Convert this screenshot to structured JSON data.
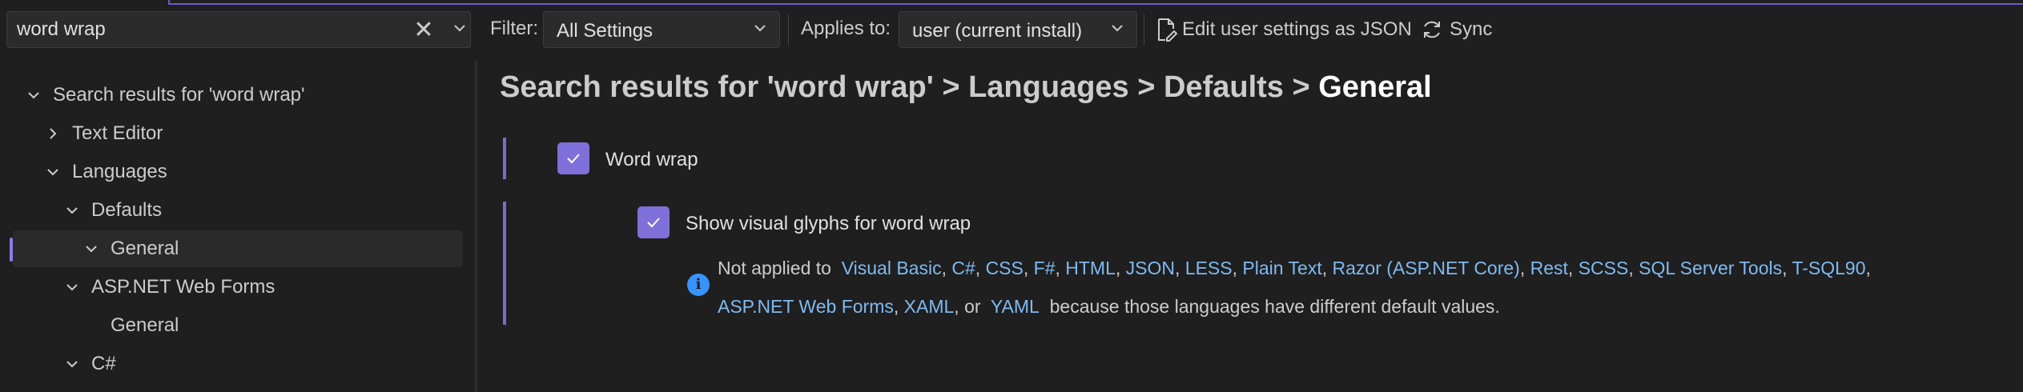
{
  "search": {
    "value": "word wrap"
  },
  "filter": {
    "label": "Filter:",
    "value": "All Settings"
  },
  "applies": {
    "label": "Applies to:",
    "value": "user (current install)"
  },
  "actions": {
    "edit_json": "Edit user settings as JSON",
    "sync": "Sync"
  },
  "tree": {
    "items": [
      {
        "label": "Search results for 'word wrap'",
        "expanded": true,
        "level": 0
      },
      {
        "label": "Text Editor",
        "expanded": false,
        "level": 1
      },
      {
        "label": "Languages",
        "expanded": true,
        "level": 1
      },
      {
        "label": "Defaults",
        "expanded": true,
        "level": 2
      },
      {
        "label": "General",
        "expanded": true,
        "level": 3,
        "selected": true
      },
      {
        "label": "ASP.NET Web Forms",
        "expanded": true,
        "level": 2
      },
      {
        "label": "General",
        "level": 3
      },
      {
        "label": "C#",
        "expanded": true,
        "level": 2
      }
    ]
  },
  "breadcrumb": {
    "path": "Search results for 'word wrap' > Languages > Defaults > ",
    "current": "General"
  },
  "settings": {
    "word_wrap": {
      "label": "Word wrap",
      "checked": true
    },
    "glyphs": {
      "label": "Show visual glyphs for word wrap",
      "checked": true
    }
  },
  "note": {
    "prefix": "Not applied to",
    "languages_line1": [
      "Visual Basic",
      "C#",
      "CSS",
      "F#",
      "HTML",
      "JSON",
      "LESS",
      "Plain Text",
      "Razor (ASP.NET Core)",
      "Rest",
      "SCSS",
      "SQL Server Tools",
      "T-SQL90"
    ],
    "languages_line2_a": "ASP.NET Web Forms",
    "languages_line2_b": "XAML",
    "or": "or",
    "languages_line2_c": "YAML",
    "suffix": "because those languages have different default values."
  },
  "colors": {
    "accent": "#7f6fd8",
    "link": "#7fbaf2",
    "info": "#3794ff",
    "background": "#1f1f1f"
  }
}
